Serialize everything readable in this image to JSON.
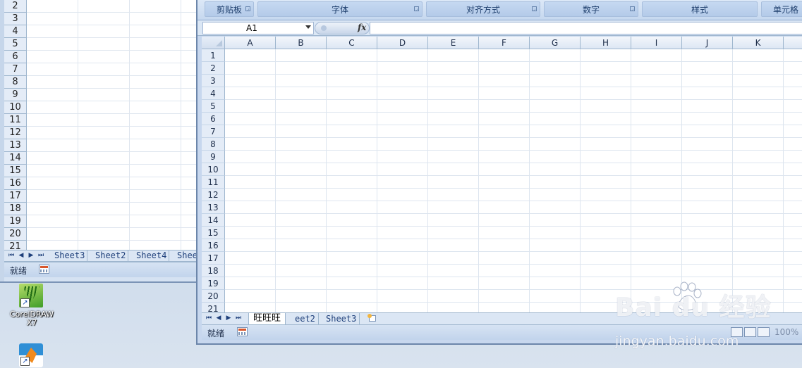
{
  "back_window": {
    "rows": [
      "2",
      "3",
      "4",
      "5",
      "6",
      "7",
      "8",
      "9",
      "10",
      "11",
      "12",
      "13",
      "14",
      "15",
      "16",
      "17",
      "18",
      "19",
      "20",
      "21"
    ],
    "nav_buttons": [
      "⏮",
      "◀",
      "▶",
      "⏭"
    ],
    "sheet_tabs": [
      "Sheet3",
      "Sheet2",
      "Sheet4",
      "Shee"
    ],
    "status": "就绪"
  },
  "desktop_icons": [
    {
      "label_line1": "CorelDRAW",
      "label_line2": "X7",
      "icon": "coreldraw-icon"
    },
    {
      "label_line1": "",
      "label_line2": "",
      "icon": "app-shortcut-icon"
    }
  ],
  "ribbon": {
    "groups": [
      {
        "label": "剪贴板",
        "has_launcher": true
      },
      {
        "label": "字体",
        "has_launcher": true
      },
      {
        "label": "对齐方式",
        "has_launcher": true
      },
      {
        "label": "数字",
        "has_launcher": true
      },
      {
        "label": "样式",
        "has_launcher": false
      },
      {
        "label": "单元格",
        "has_launcher": false
      }
    ]
  },
  "formula_bar": {
    "name_box": "A1",
    "fx_label": "fx",
    "formula_value": ""
  },
  "grid": {
    "columns": [
      "A",
      "B",
      "C",
      "D",
      "E",
      "F",
      "G",
      "H",
      "I",
      "J",
      "K"
    ],
    "rows": [
      "1",
      "2",
      "3",
      "4",
      "5",
      "6",
      "7",
      "8",
      "9",
      "10",
      "11",
      "12",
      "13",
      "14",
      "15",
      "16",
      "17",
      "18",
      "19",
      "20",
      "21"
    ],
    "selected_cell": "A1"
  },
  "sheet_tabs": {
    "nav_buttons": [
      "⏮",
      "◀",
      "▶",
      "⏭"
    ],
    "tabs": [
      "旺旺旺",
      "eet2",
      "Sheet3"
    ],
    "active_index": 0
  },
  "status_bar": {
    "status": "就绪",
    "zoom": "100%"
  },
  "watermark": {
    "brand": "Bai du 经验",
    "url": "jingyan.baidu.com"
  },
  "colors": {
    "ribbon_text": "#20406e",
    "grid_line": "#dde5ef",
    "header_bg": "#e4ecf7",
    "window_frame": "#6c86aa"
  }
}
